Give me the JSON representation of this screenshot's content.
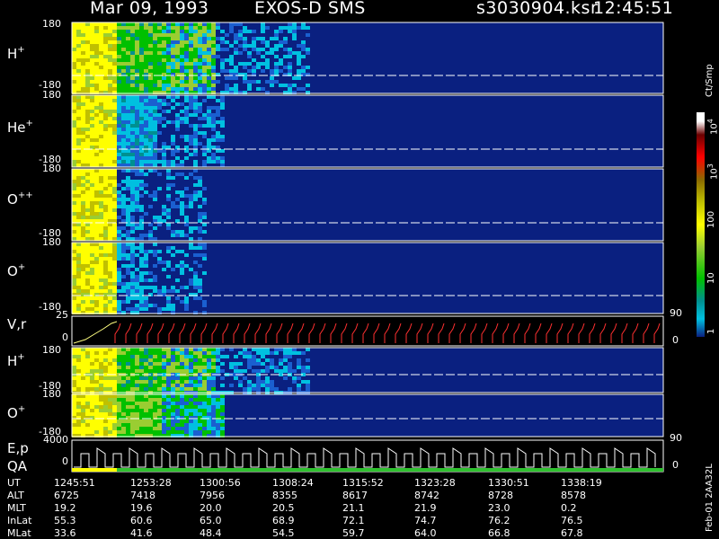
{
  "header": {
    "date": "Mar 09, 1993",
    "instrument": "EXOS-D SMS",
    "file": "s3030904.ksr",
    "time": "12:45:51"
  },
  "panels": [
    {
      "species": "H",
      "charge": "+",
      "top_tick": "180",
      "bottom_tick": "-180"
    },
    {
      "species": "He",
      "charge": "+",
      "top_tick": "180",
      "bottom_tick": "-180"
    },
    {
      "species": "O",
      "charge": "++",
      "top_tick": "180",
      "bottom_tick": "-180"
    },
    {
      "species": "O",
      "charge": "+",
      "top_tick": "180",
      "bottom_tick": "-180"
    }
  ],
  "vr_panel": {
    "label": "V,r",
    "top_tick": "25",
    "mid_tick": "0",
    "right_top": "90",
    "right_bottom": "0"
  },
  "lower_panels": [
    {
      "species": "H",
      "charge": "+",
      "top_tick": "180",
      "bottom_tick": "-180"
    },
    {
      "species": "O",
      "charge": "+",
      "top_tick": "180",
      "bottom_tick": "-180"
    }
  ],
  "ep_panel": {
    "label1": "E,p",
    "label2": "QA",
    "top_tick": "4000",
    "mid_tick": "0",
    "right_top": "90",
    "right_bottom": "0"
  },
  "colorbar": {
    "unit_label": "Ct/Smp",
    "ticks": [
      "10",
      "3",
      "10",
      "100",
      "10",
      "1"
    ],
    "exp_top": "4",
    "exp_mid": "3",
    "colors": [
      "#ffffff",
      "#ff0000",
      "#6b0000",
      "#8a6a00",
      "#c0c000",
      "#ffff00",
      "#9acd32",
      "#00c000",
      "#009090",
      "#00c0e0",
      "#0a2080"
    ]
  },
  "right_scale_label": "90",
  "footer": {
    "labels": [
      "UT",
      "ALT",
      "MLT",
      "InLat",
      "MLat"
    ],
    "columns": [
      [
        "1245:51",
        "6725",
        "19.2",
        "55.3",
        "33.6"
      ],
      [
        "1253:28",
        "7418",
        "19.6",
        "60.6",
        "41.6"
      ],
      [
        "1300:56",
        "7956",
        "20.0",
        "65.0",
        "48.4"
      ],
      [
        "1308:24",
        "8355",
        "20.5",
        "68.9",
        "54.5"
      ],
      [
        "1315:52",
        "8617",
        "21.1",
        "72.1",
        "59.7"
      ],
      [
        "1323:28",
        "8742",
        "21.9",
        "74.7",
        "64.0"
      ],
      [
        "1330:51",
        "8728",
        "23.0",
        "76.2",
        "66.8"
      ],
      [
        "1338:19",
        "8578",
        "0.2",
        "76.5",
        "67.8"
      ]
    ]
  },
  "side_label": "Feb-01 2AA32L"
}
